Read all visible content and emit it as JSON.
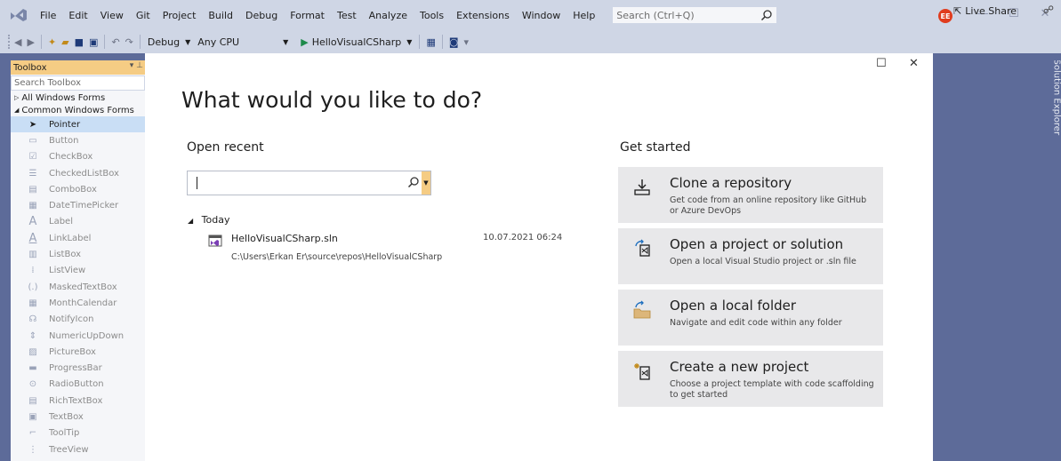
{
  "menubar": {
    "items": [
      "File",
      "Edit",
      "View",
      "Git",
      "Project",
      "Build",
      "Debug",
      "Format",
      "Test",
      "Analyze",
      "Tools",
      "Extensions",
      "Window",
      "Help"
    ],
    "search_placeholder": "Search (Ctrl+Q)",
    "avatar_initials": "EE"
  },
  "toolbar": {
    "config": "Debug",
    "platform": "Any CPU",
    "run_target": "HelloVisualCSharp",
    "live_share": "Live Share"
  },
  "toolbox": {
    "title": "Toolbox",
    "search_placeholder": "Search Toolbox",
    "category_all": "All Windows Forms",
    "category_common": "Common Windows Forms",
    "items": [
      {
        "label": "Pointer",
        "icon": "pointer-icon"
      },
      {
        "label": "Button",
        "icon": "button-icon"
      },
      {
        "label": "CheckBox",
        "icon": "checkbox-icon"
      },
      {
        "label": "CheckedListBox",
        "icon": "checkedlistbox-icon"
      },
      {
        "label": "ComboBox",
        "icon": "combobox-icon"
      },
      {
        "label": "DateTimePicker",
        "icon": "datetimepicker-icon"
      },
      {
        "label": "Label",
        "icon": "label-icon"
      },
      {
        "label": "LinkLabel",
        "icon": "linklabel-icon"
      },
      {
        "label": "ListBox",
        "icon": "listbox-icon"
      },
      {
        "label": "ListView",
        "icon": "listview-icon"
      },
      {
        "label": "MaskedTextBox",
        "icon": "maskedtextbox-icon"
      },
      {
        "label": "MonthCalendar",
        "icon": "monthcalendar-icon"
      },
      {
        "label": "NotifyIcon",
        "icon": "notifyicon-icon"
      },
      {
        "label": "NumericUpDown",
        "icon": "numericupdown-icon"
      },
      {
        "label": "PictureBox",
        "icon": "picturebox-icon"
      },
      {
        "label": "ProgressBar",
        "icon": "progressbar-icon"
      },
      {
        "label": "RadioButton",
        "icon": "radiobutton-icon"
      },
      {
        "label": "RichTextBox",
        "icon": "richtextbox-icon"
      },
      {
        "label": "TextBox",
        "icon": "textbox-icon"
      },
      {
        "label": "ToolTip",
        "icon": "tooltip-icon"
      },
      {
        "label": "TreeView",
        "icon": "treeview-icon"
      }
    ]
  },
  "solution_explorer": {
    "label": "Solution Explorer"
  },
  "start_window": {
    "title": "What would you like to do?",
    "open_recent": "Open recent",
    "today": "Today",
    "recent": {
      "name": "HelloVisualCSharp.sln",
      "path": "C:\\Users\\Erkan Er\\source\\repos\\HelloVisualCSharp",
      "date": "10.07.2021 06:24"
    },
    "get_started": "Get started",
    "cards": [
      {
        "title": "Clone a repository",
        "desc": "Get code from an online repository like GitHub or Azure DevOps"
      },
      {
        "title": "Open a project or solution",
        "desc": "Open a local Visual Studio project or .sln file"
      },
      {
        "title": "Open a local folder",
        "desc": "Navigate and edit code within any folder"
      },
      {
        "title": "Create a new project",
        "desc": "Choose a project template with code scaffolding to get started"
      }
    ]
  },
  "colors": {
    "chrome": "#cfd6e5",
    "workspace": "#5d6b99",
    "toolbox_header": "#f5cc84",
    "selected": "#c9def5",
    "card": "#e8e8ea"
  }
}
